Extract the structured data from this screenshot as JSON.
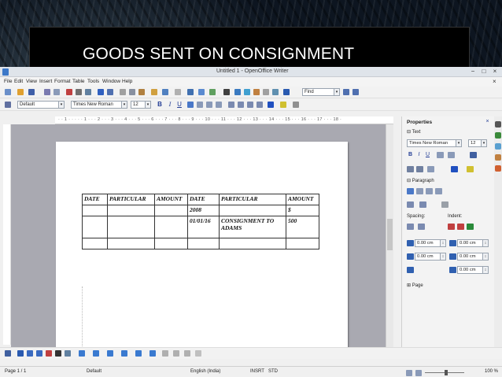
{
  "slide": {
    "title": "GOODS SENT ON CONSIGNMENT"
  },
  "window": {
    "title": "Untitled 1 - OpenOffice Writer",
    "minimize": "−",
    "maximize": "□",
    "close": "×"
  },
  "menu": {
    "items": [
      "File",
      "Edit",
      "View",
      "Insert",
      "Format",
      "Table",
      "Tools",
      "Window",
      "Help"
    ],
    "close_doc": "×"
  },
  "standard_toolbar": {
    "find_placeholder": "Find"
  },
  "formatting_toolbar": {
    "paragraph_style": "Default",
    "font_name": "Times New Roman",
    "font_size": "12",
    "bold": "B",
    "italic": "I",
    "underline": "U"
  },
  "ruler": {
    "text": "· · 1 · · · · · 1 · · · 2 · · · 3 · · · 4 · · · 5 · · · 6 · · · 7 · · · 8 · · · 9 · · · 10 · · · 11 · · · 12 · · · 13 · · · 14 · · · 15 · · · 16 · · · 17 · · · 18 ·"
  },
  "document_table": {
    "header": [
      "DATE",
      "PARTICULAR",
      "AMOUNT",
      "DATE",
      "PARTICULAR",
      "AMOUNT"
    ],
    "rows": [
      [
        "",
        "",
        "",
        "2008",
        "",
        "$"
      ],
      [
        "",
        "",
        "",
        "01/01/16",
        "CONSIGNMENT TO ADAMS",
        "500"
      ],
      [
        "",
        "",
        "",
        "",
        "",
        ""
      ]
    ]
  },
  "sidebar": {
    "title": "Properties",
    "text_section": "Text",
    "font_name": "Times New Roman",
    "font_size": "12",
    "paragraph_section": "Paragraph",
    "spacing_label": "Spacing:",
    "indent_label": "Indent:",
    "spacing_above": "0.00 cm",
    "spacing_below": "0.00 cm",
    "indent_before": "0.00 cm",
    "indent_after": "0.00 cm",
    "indent_first": "0.00 cm",
    "page_section": "Page"
  },
  "statusbar": {
    "page": "Page 1 / 1",
    "style": "Default",
    "language": "English (India)",
    "insert_mode": "INSRT",
    "selection_mode": "STD",
    "zoom": "100 %"
  },
  "colors": {
    "accent": "#1f3a93",
    "sidebar_bg": "#f3f3f3",
    "doc_bg": "#a9a9b1"
  }
}
